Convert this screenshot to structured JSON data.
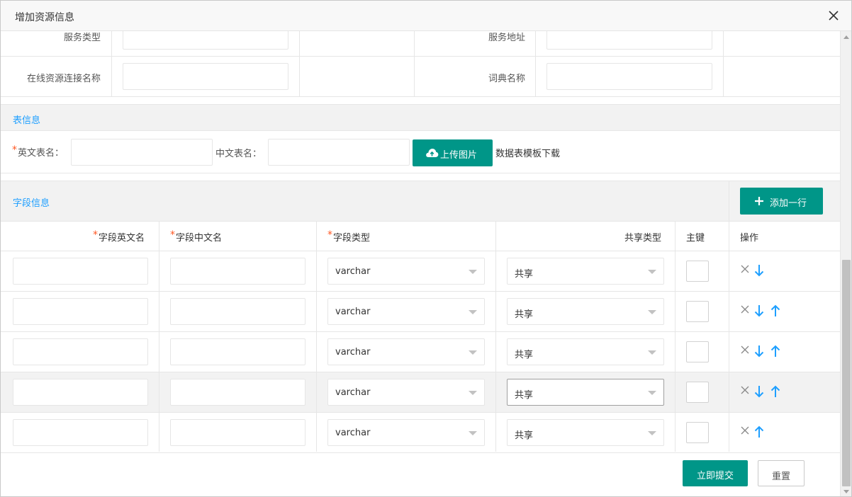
{
  "dialog": {
    "title": "增加资源信息",
    "close_icon": "close-icon"
  },
  "service": {
    "service_type_label": "服务类型",
    "service_address_label": "服务地址",
    "online_conn_label": "在线资源连接名称",
    "dict_name_label": "词典名称"
  },
  "table_info": {
    "section_title": "表信息",
    "en_name_label": "英文表名：",
    "cn_name_label": "中文表名：",
    "upload_button": "上传图片",
    "template_link": "数据表模板下载",
    "required_mark": "*"
  },
  "field_info": {
    "section_title": "字段信息",
    "add_row_button": "添加一行",
    "columns": {
      "en_name": "字段英文名",
      "cn_name": "字段中文名",
      "type": "字段类型",
      "share_type": "共享类型",
      "primary_key": "主键",
      "actions": "操作"
    },
    "required_mark": "*",
    "rows": [
      {
        "type": "varchar",
        "share": "共享",
        "ops": [
          "delete",
          "down"
        ]
      },
      {
        "type": "varchar",
        "share": "共享",
        "ops": [
          "delete",
          "down",
          "up"
        ]
      },
      {
        "type": "varchar",
        "share": "共享",
        "ops": [
          "delete",
          "down",
          "up"
        ]
      },
      {
        "type": "varchar",
        "share": "共享",
        "ops": [
          "delete",
          "down",
          "up"
        ],
        "hover": true
      },
      {
        "type": "varchar",
        "share": "共享",
        "ops": [
          "delete",
          "up"
        ]
      }
    ]
  },
  "footer": {
    "submit_button": "立即提交",
    "reset_button": "重置"
  },
  "colors": {
    "accent": "#009688",
    "link": "#1e9fff",
    "required": "#ff5722"
  }
}
